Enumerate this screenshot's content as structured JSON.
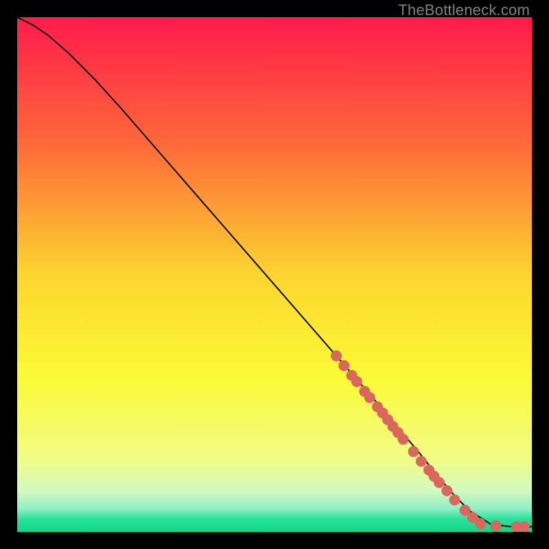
{
  "watermark": "TheBottleneck.com",
  "chart_data": {
    "type": "line",
    "title": "",
    "xlabel": "",
    "ylabel": "",
    "xlim": [
      0,
      100
    ],
    "ylim": [
      0,
      100
    ],
    "grid": false,
    "background_gradient_stops": [
      {
        "offset": 0,
        "color": "#ff1a4b"
      },
      {
        "offset": 0.25,
        "color": "#fe6a3a"
      },
      {
        "offset": 0.5,
        "color": "#fcd52f"
      },
      {
        "offset": 0.7,
        "color": "#fbfa35"
      },
      {
        "offset": 0.86,
        "color": "#f0fc86"
      },
      {
        "offset": 0.92,
        "color": "#d2fac0"
      },
      {
        "offset": 0.955,
        "color": "#8ff0c5"
      },
      {
        "offset": 0.975,
        "color": "#28e39b"
      },
      {
        "offset": 1.0,
        "color": "#12d487"
      }
    ],
    "series": [
      {
        "name": "curve",
        "stroke": "#000000",
        "x": [
          0,
          3,
          6,
          10,
          15,
          20,
          30,
          40,
          50,
          60,
          70,
          78,
          82,
          85,
          88,
          92,
          96,
          100
        ],
        "y": [
          100,
          98.5,
          96.5,
          93,
          88,
          82.5,
          71,
          59.5,
          48,
          36.5,
          25,
          15.5,
          10.5,
          7,
          4,
          1.5,
          1,
          1
        ]
      }
    ],
    "marker_series": [
      {
        "name": "dots",
        "color": "#d9675e",
        "radius_px": 8,
        "x": [
          62,
          63.5,
          65,
          66,
          67.5,
          68.5,
          70,
          71,
          72,
          73,
          74,
          75,
          77,
          78.5,
          80,
          81,
          82,
          83.5,
          85,
          87,
          88.5,
          90,
          93,
          97,
          98.5
        ],
        "y": [
          34.2,
          32.3,
          30.4,
          29.2,
          27.3,
          26.1,
          24.3,
          23.1,
          21.8,
          20.5,
          19.3,
          18.0,
          15.6,
          13.7,
          12.0,
          10.8,
          9.6,
          8.0,
          6.2,
          4.2,
          2.8,
          1.6,
          1.2,
          1.0,
          1.0
        ]
      }
    ]
  }
}
